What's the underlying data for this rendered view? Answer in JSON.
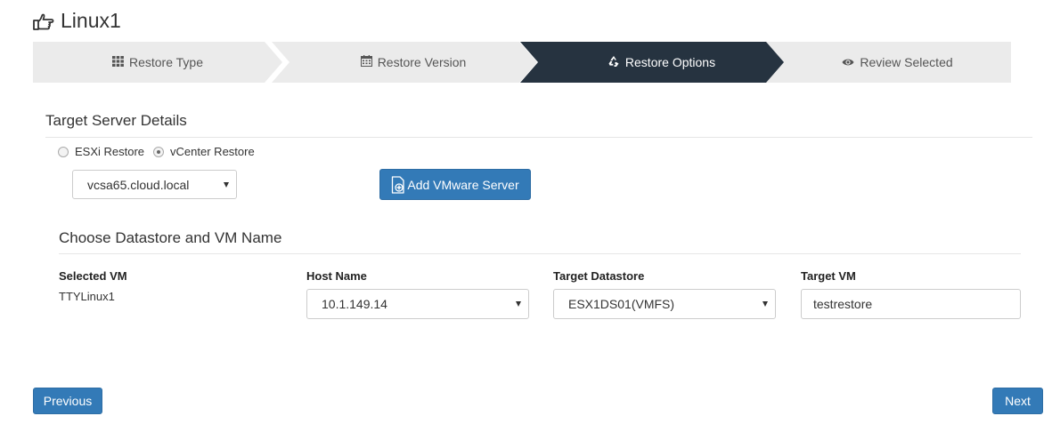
{
  "page": {
    "title": "Linux1",
    "title_icon": "hand-pointing-icon"
  },
  "steps": [
    {
      "label": "Restore Type",
      "icon": "grid-icon",
      "active": false
    },
    {
      "label": "Restore Version",
      "icon": "calendar-icon",
      "active": false
    },
    {
      "label": "Restore Options",
      "icon": "recycle-icon",
      "active": true
    },
    {
      "label": "Review Selected",
      "icon": "eye-icon",
      "active": false
    }
  ],
  "target_server": {
    "heading": "Target Server Details",
    "radio_esxi": "ESXi Restore",
    "radio_vcenter": "vCenter Restore",
    "selected_radio": "vCenter Restore",
    "server_select_value": "vcsa65.cloud.local",
    "add_server_label": "Add VMware Server"
  },
  "datastore": {
    "heading": "Choose Datastore and VM Name",
    "col_selected_vm": "Selected VM",
    "col_host_name": "Host Name",
    "col_target_datastore": "Target Datastore",
    "col_target_vm": "Target VM",
    "selected_vm_value": "TTYLinux1",
    "host_name_value": "10.1.149.14",
    "target_datastore_value": "ESX1DS01(VMFS)",
    "target_vm_value": "testrestore"
  },
  "footer": {
    "previous_label": "Previous",
    "next_label": "Next"
  },
  "colors": {
    "active_step_bg": "#263340",
    "inactive_step_bg": "#ebebeb",
    "primary_button": "#337ab7"
  }
}
